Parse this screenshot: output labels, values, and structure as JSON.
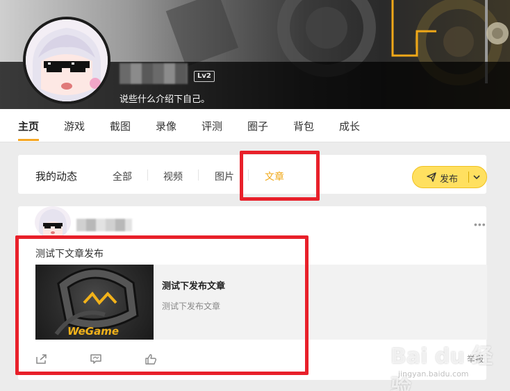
{
  "profile": {
    "level_badge": "Lv2",
    "bio": "说些什么介绍下自己。"
  },
  "nav": {
    "tabs": [
      "主页",
      "游戏",
      "截图",
      "录像",
      "评测",
      "圈子",
      "背包",
      "成长"
    ],
    "active": "主页"
  },
  "feed": {
    "title": "我的动态",
    "filters": [
      "全部",
      "视频",
      "图片",
      "文章"
    ],
    "active_filter": "文章",
    "publish_label": "发布"
  },
  "post": {
    "text": "测试下文章发布",
    "article": {
      "title": "测试下发布文章",
      "description": "测试下发布文章",
      "thumbnail_text": "WeGame"
    },
    "report_label": "举报",
    "actions": [
      "share-icon",
      "comment-icon",
      "like-icon"
    ]
  },
  "watermark": {
    "logo": "Bai du 经验",
    "url": "jingyan.baidu.com"
  },
  "colors": {
    "accent": "#f5a623",
    "publish_button": "#ffe060",
    "annotation": "#e8202a"
  }
}
